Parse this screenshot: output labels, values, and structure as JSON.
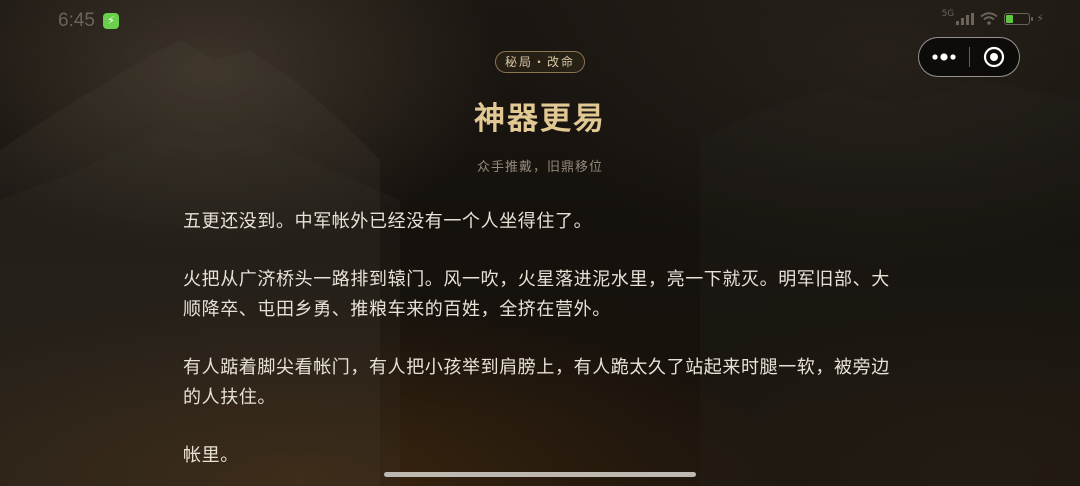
{
  "status_bar": {
    "time": "6:45",
    "network": "5G",
    "icons": [
      "app-charging-badge-icon",
      "cellular-signal-icon",
      "wifi-icon",
      "battery-icon",
      "charging-bolt-icon"
    ]
  },
  "capsule": {
    "more_icon": "more-dots-icon",
    "close_icon": "close-target-icon"
  },
  "chapter": {
    "tag": "秘局・改命",
    "title": "神器更易",
    "subtitle": "众手推戴，旧鼎移位"
  },
  "article": {
    "paragraphs": [
      "五更还没到。中军帐外已经没有一个人坐得住了。",
      "火把从广济桥头一路排到辕门。风一吹，火星落进泥水里，亮一下就灭。明军旧部、大顺降卒、屯田乡勇、推粮车来的百姓，全挤在营外。",
      "有人踮着脚尖看帐门，有人把小孩举到肩膀上，有人跪太久了站起来时腿一软，被旁边的人扶住。",
      "帐里。"
    ]
  },
  "colors": {
    "title_gold": "#e2c994",
    "body_text": "#e8e2d6",
    "tag_border": "#8a7553",
    "battery_green": "#5ec640"
  }
}
